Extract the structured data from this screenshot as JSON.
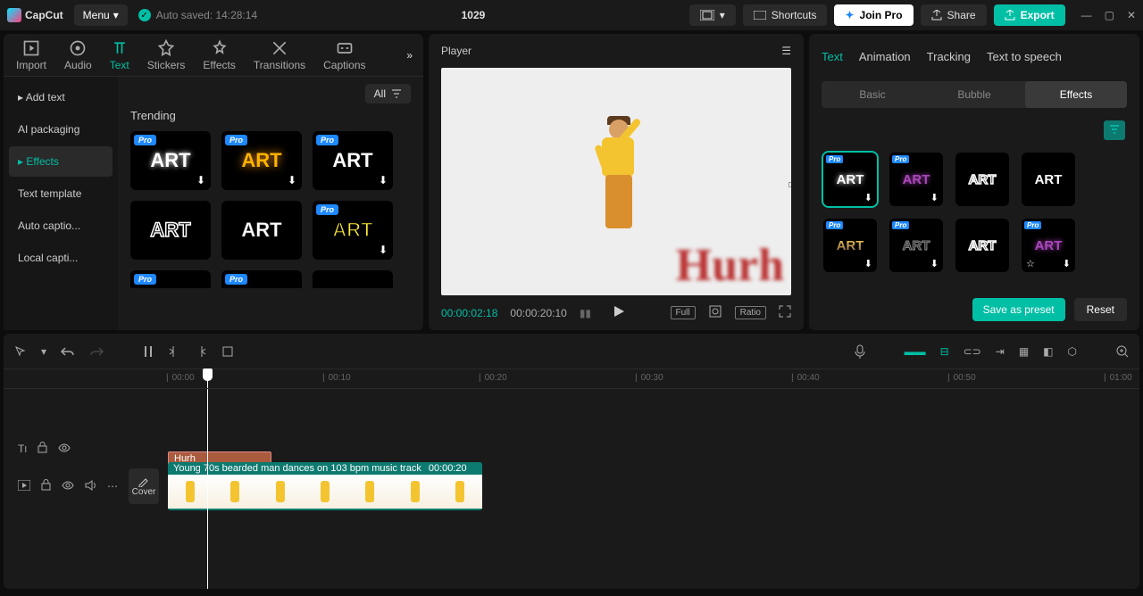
{
  "app": {
    "name": "CapCut",
    "menu": "Menu",
    "autosaved": "Auto saved: 14:28:14",
    "title": "1029"
  },
  "topbar": {
    "shortcuts": "Shortcuts",
    "joinpro": "Join Pro",
    "share": "Share",
    "export": "Export"
  },
  "mediaTabs": [
    "Import",
    "Audio",
    "Text",
    "Stickers",
    "Effects",
    "Transitions",
    "Captions"
  ],
  "sidebar": [
    "▸ Add text",
    "AI packaging",
    "▸ Effects",
    "Text template",
    "Auto captio...",
    "Local capti..."
  ],
  "gallery": {
    "filter": "All",
    "trending": "Trending",
    "items": [
      {
        "pro": true,
        "cls": "art-white",
        "dl": true
      },
      {
        "pro": true,
        "cls": "art-gold",
        "dl": true
      },
      {
        "pro": true,
        "cls": "art-plain",
        "dl": true
      },
      {
        "pro": false,
        "cls": "art-outline",
        "dl": false
      },
      {
        "pro": false,
        "cls": "art-outline2",
        "dl": false
      },
      {
        "pro": true,
        "cls": "art-yellow",
        "dl": true
      }
    ],
    "partial": [
      {
        "pro": true
      },
      {
        "pro": true
      },
      {
        "pro": false
      }
    ]
  },
  "player": {
    "label": "Player",
    "current": "00:00:02:18",
    "duration": "00:00:20:10",
    "full": "Full",
    "ratio": "Ratio",
    "overlayText": "Hurh"
  },
  "inspector": {
    "tabs": [
      "Text",
      "Animation",
      "Tracking",
      "Text to speech"
    ],
    "subtabs": [
      "Basic",
      "Bubble",
      "Effects"
    ],
    "savePreset": "Save as preset",
    "reset": "Reset",
    "effects": [
      {
        "pro": true,
        "cls": "art-white",
        "dl": true,
        "sel": true
      },
      {
        "pro": true,
        "cls": "art-purple",
        "dl": true
      },
      {
        "pro": false,
        "cls": "art-outline"
      },
      {
        "pro": false,
        "cls": "art-plain"
      },
      {
        "pro": true,
        "cls": "art-goldthin",
        "dl": true
      },
      {
        "pro": true,
        "cls": "art-gray",
        "dl": true
      },
      {
        "pro": false,
        "cls": "art-outline"
      },
      {
        "pro": true,
        "cls": "art-purple",
        "dl": true,
        "star": true
      }
    ]
  },
  "timeline": {
    "marks": [
      "00:00",
      "00:10",
      "00:20",
      "00:30",
      "00:40",
      "00:50",
      "01:00"
    ],
    "textClip": "Hurh",
    "videoClip": {
      "name": "Young 70s bearded man dances on 103 bpm music track",
      "dur": "00:00:20"
    },
    "cover": "Cover"
  }
}
